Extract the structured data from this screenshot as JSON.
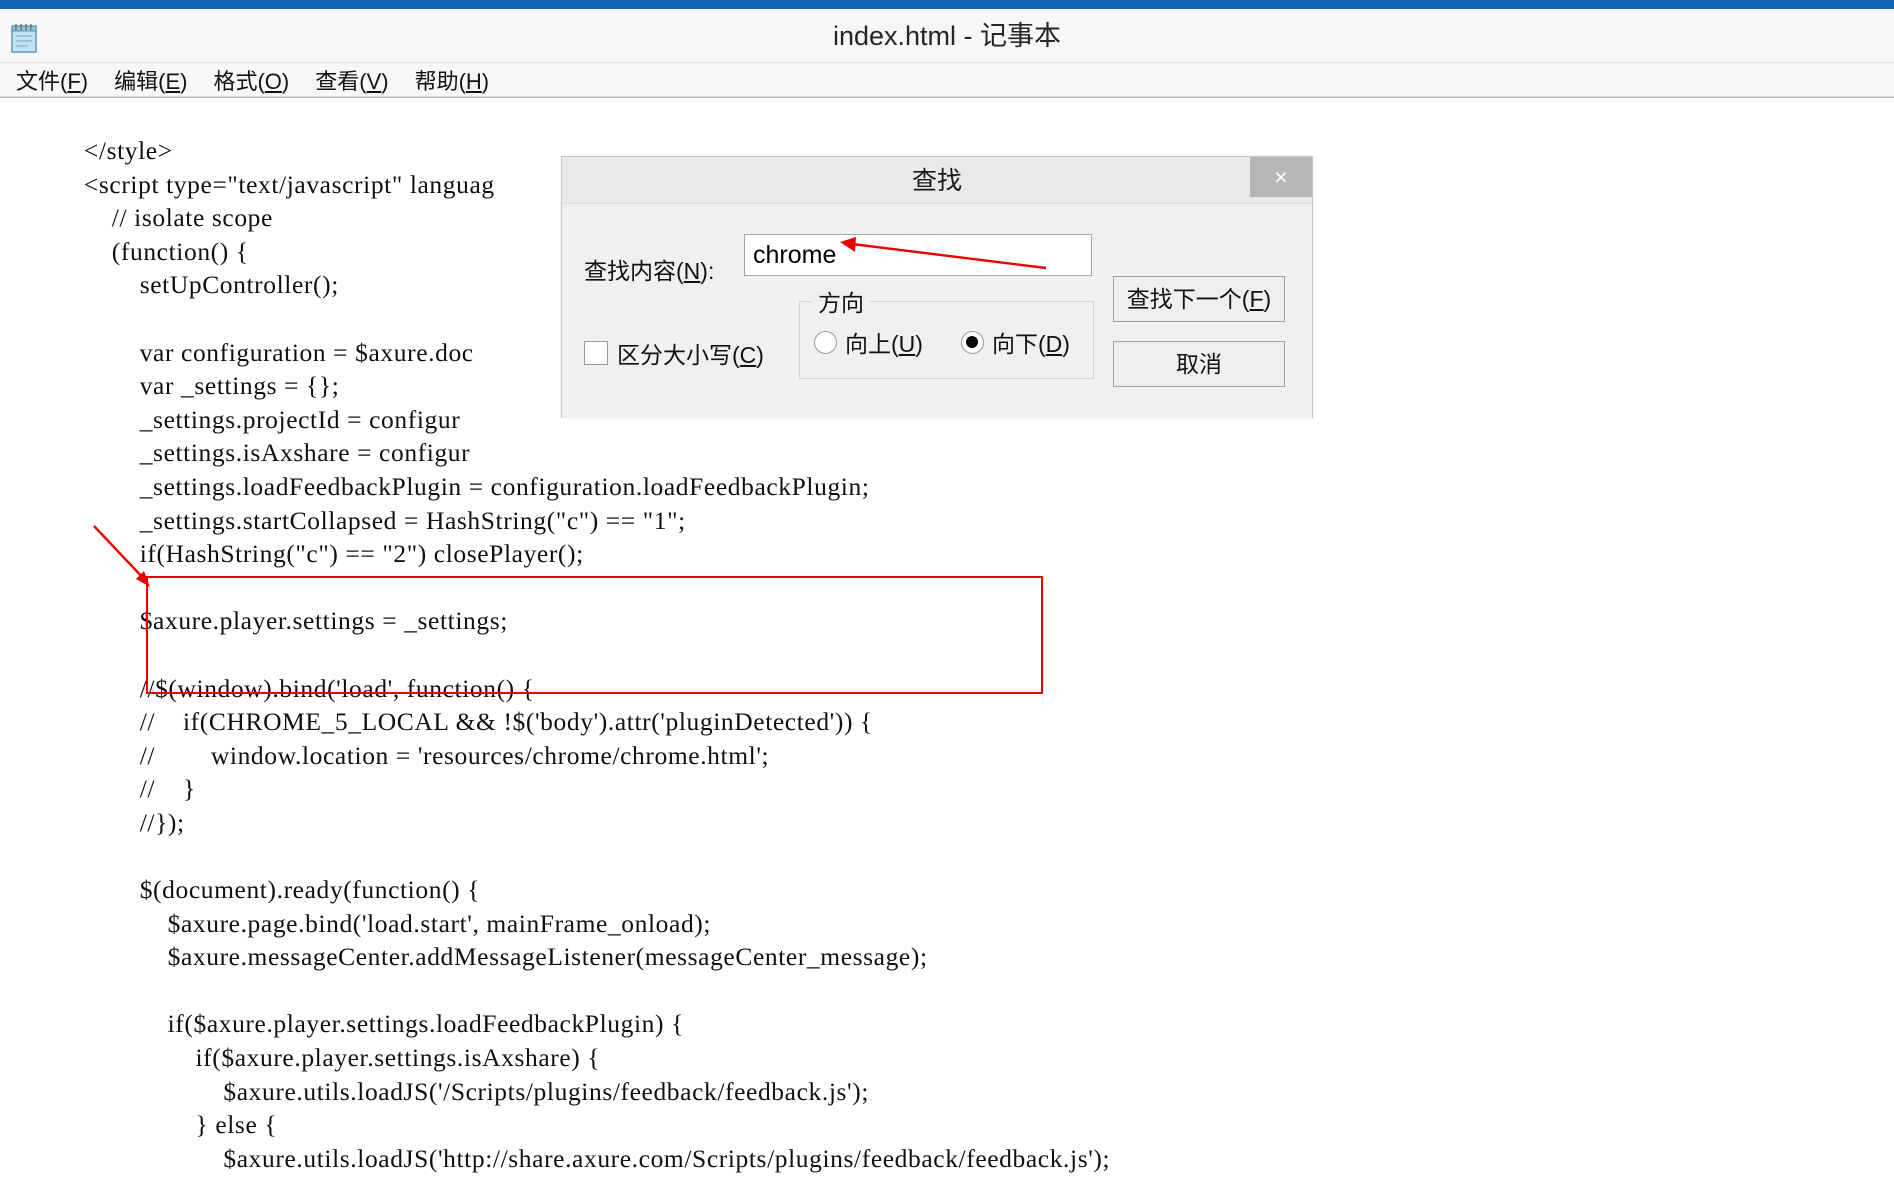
{
  "window": {
    "title": "index.html - 记事本",
    "icon": "notepad-icon",
    "accent_color": "#1763b3"
  },
  "menubar": {
    "items": [
      {
        "label": "文件(F)",
        "text": "文件(",
        "mnemonic": "F",
        "tail": ")"
      },
      {
        "label": "编辑(E)",
        "text": "编辑(",
        "mnemonic": "E",
        "tail": ")"
      },
      {
        "label": "格式(O)",
        "text": "格式(",
        "mnemonic": "O",
        "tail": ")"
      },
      {
        "label": "查看(V)",
        "text": "查看(",
        "mnemonic": "V",
        "tail": ")"
      },
      {
        "label": "帮助(H)",
        "text": "帮助(",
        "mnemonic": "H",
        "tail": ")"
      }
    ]
  },
  "editor": {
    "content": "    </style>\n    <script type=\"text/javascript\" languag\n        // isolate scope\n        (function() {\n            setUpController();\n\n            var configuration = $axure.doc\n            var _settings = {};\n            _settings.projectId = configur\n            _settings.isAxshare = configur\n            _settings.loadFeedbackPlugin = configuration.loadFeedbackPlugin;\n            _settings.startCollapsed = HashString(\"c\") == \"1\";\n            if(HashString(\"c\") == \"2\") closePlayer();\n\n            $axure.player.settings = _settings;\n\n            //$(window).bind('load', function() {\n            //    if(CHROME_5_LOCAL && !$('body').attr('pluginDetected')) {\n            //        window.location = 'resources/chrome/chrome.html';\n            //    }\n            //});\n\n            $(document).ready(function() {\n                $axure.page.bind('load.start', mainFrame_onload);\n                $axure.messageCenter.addMessageListener(messageCenter_message);\n\n                if($axure.player.settings.loadFeedbackPlugin) {\n                    if($axure.player.settings.isAxshare) {\n                        $axure.utils.loadJS('/Scripts/plugins/feedback/feedback.js');\n                    } else {\n                        $axure.utils.loadJS('http://share.axure.com/Scripts/plugins/feedback/feedback.js');"
  },
  "find_dialog": {
    "title": "查找",
    "close_label": "×",
    "find_what": {
      "label_text": "查找内容(",
      "label_mnemonic": "N",
      "label_tail": "):",
      "value": "chrome"
    },
    "match_case": {
      "label_text": "区分大小写(",
      "label_mnemonic": "C",
      "label_tail": ")",
      "checked": false
    },
    "direction": {
      "legend": "方向",
      "options": [
        {
          "label_text": "向上(",
          "mnemonic": "U",
          "tail": ")",
          "selected": false
        },
        {
          "label_text": "向下(",
          "mnemonic": "D",
          "tail": ")",
          "selected": true
        }
      ]
    },
    "buttons": {
      "find_next": {
        "text": "查找下一个(",
        "mnemonic": "F",
        "tail": ")"
      },
      "cancel": {
        "text": "取消"
      }
    }
  },
  "annotations": {
    "highlight_color": "#ee0000",
    "arrow_to_input": true,
    "arrow_to_code_box": true
  }
}
